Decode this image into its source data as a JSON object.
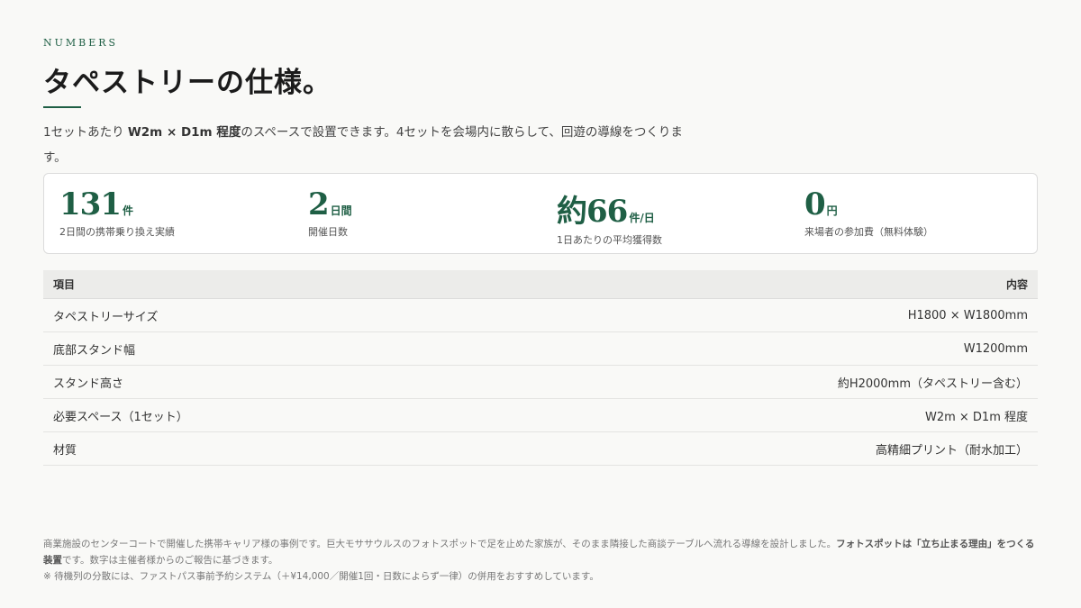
{
  "header": {
    "eyebrow": "NUMBERS",
    "title": "タペストリーの仕様。"
  },
  "intro": {
    "part1": "1セットあたり ",
    "bold1": "W2m × D1m 程度",
    "part2": "のスペースで設置できます。4セットを会場内に散らして、回遊の導線をつくります。"
  },
  "stats": [
    {
      "value": "131",
      "unit": "件",
      "label": "2日間の携帯乗り換え実績"
    },
    {
      "value": "2",
      "unit": "日間",
      "label": "開催日数"
    },
    {
      "value": "約66",
      "unit": "件/日",
      "label": "1日あたりの平均獲得数"
    },
    {
      "value": "0",
      "unit": "円",
      "label": "来場者の参加費（無料体験）"
    }
  ],
  "spec_table": {
    "headers": {
      "item": "項目",
      "content": "内容"
    },
    "rows": [
      {
        "item": "タペストリーサイズ",
        "value": "H1800 × W1800mm"
      },
      {
        "item": "底部スタンド幅",
        "value": "W1200mm"
      },
      {
        "item": "スタンド高さ",
        "value": "約H2000mm（タペストリー含む）"
      },
      {
        "item": "必要スペース（1セット）",
        "value": "W2m × D1m 程度"
      },
      {
        "item": "材質",
        "value": "高精細プリント（耐水加工）"
      }
    ]
  },
  "footnote": {
    "line1a": "商業施設のセンターコートで開催した携帯キャリア様の事例です。巨大モササウルスのフォトスポットで足を止めた家族が、そのまま隣接した商談テーブルへ流れる導線を設計しました。",
    "line1b": "フォトスポットは「立ち止まる理由」をつくる装置",
    "line1c": "です。数字は主催者様からのご報告に基づきます。",
    "line2": "※ 待機列の分散には、ファストパス事前予約システム（＋¥14,000／開催1回・日数によらず一律）の併用をおすすめしています。"
  }
}
